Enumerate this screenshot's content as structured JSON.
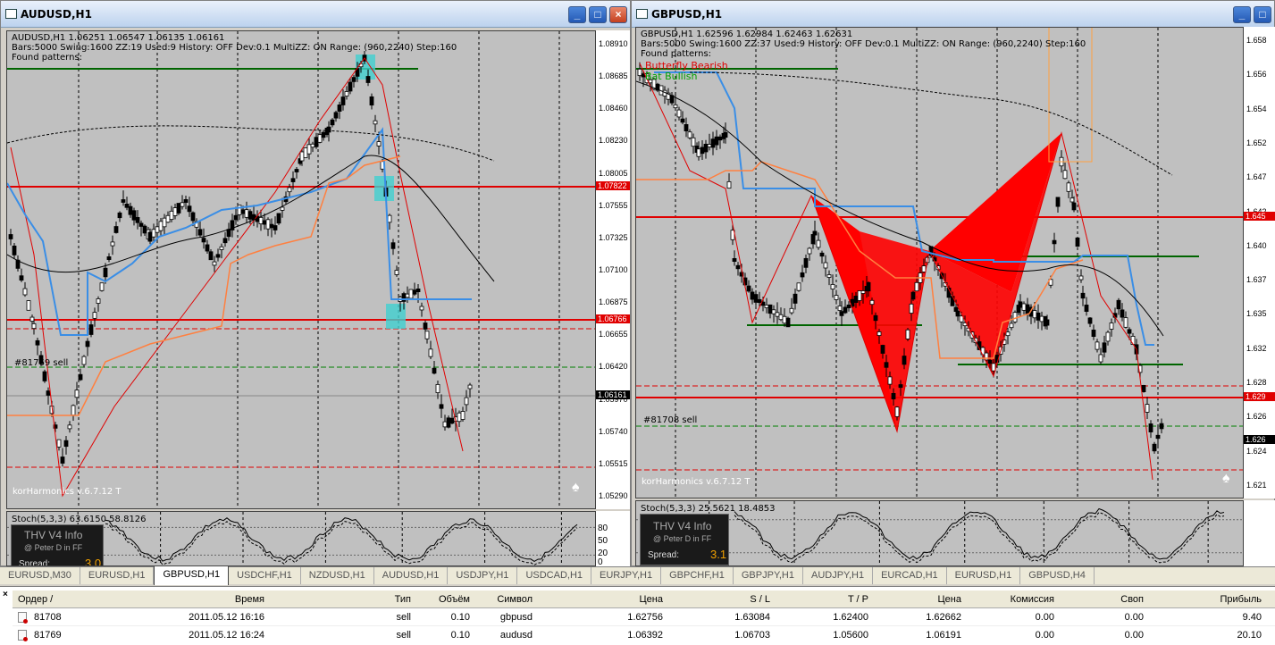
{
  "windows": [
    {
      "id": "audusd",
      "title": "AUDUSD,H1",
      "header_line1": "AUDUSD,H1  1.06251 1.06547 1.06135 1.06161",
      "header_line2": "Bars:5000  Swing:1600  ZZ:19  Used:9  History: OFF Dev:0.1  MultiZZ: ON  Range: (960,2240)  Step:160",
      "header_line3": "Found patterns:",
      "order_label": "#81769 sell",
      "brand": "korHarmonics v.6.7.12 T",
      "osc_label": "Stoch(5,3,3) 63.6150 58.8126",
      "price_labels": [
        "1.08910",
        "1.08685",
        "1.08460",
        "1.08230",
        "1.08005",
        "1.07555",
        "1.07325",
        "1.07100",
        "1.06875",
        "1.06655",
        "1.06420",
        "1.05970",
        "1.05740",
        "1.05515",
        "1.05290"
      ],
      "marker_red_1": "1.07822",
      "marker_red_2": "1.06766",
      "marker_black": "1.06161",
      "osc_ticks": [
        "80",
        "50",
        "20",
        "0"
      ],
      "thv": {
        "title": "THV  V4  Info",
        "sub": "@ Peter D in FF",
        "spread_label": "Spread:",
        "spread_value": "3.0"
      }
    },
    {
      "id": "gbpusd",
      "title": "GBPUSD,H1",
      "header_line1": "GBPUSD,H1  1.62596  1.62984  1.62463  1.62631",
      "header_line2": "Bars:5000  Swing:1600  ZZ:37  Used:9  History: OFF Dev:0.1  MultiZZ: ON  Range: (960,2240)  Step:160",
      "header_line3": "Found patterns:",
      "pattern1": "Butterfly Bearish",
      "pattern2": "Bat Bullish",
      "order_label": "#81708 sell",
      "brand": "korHarmonics v.6.7.12 T",
      "osc_label": "Stoch(5,3,3) 25.5621 18.4853",
      "price_labels": [
        "1.658",
        "1.656",
        "1.654",
        "1.652",
        "1.647",
        "1.642",
        "1.640",
        "1.637",
        "1.635",
        "1.632",
        "1.628",
        "1.626",
        "1.624",
        "1.621"
      ],
      "marker_red_1": "1.645",
      "marker_red_2": "1.629",
      "marker_black": "1.626",
      "thv": {
        "title": "THV  V4  Info",
        "sub": "@ Peter D in FF",
        "spread_label": "Spread:",
        "spread_value": "3.1"
      }
    }
  ],
  "tabs": [
    "EURUSD,M30",
    "EURUSD,H1",
    "GBPUSD,H1",
    "USDCHF,H1",
    "NZDUSD,H1",
    "AUDUSD,H1",
    "USDJPY,H1",
    "USDCAD,H1",
    "EURJPY,H1",
    "GBPCHF,H1",
    "GBPJPY,H1",
    "AUDJPY,H1",
    "EURCAD,H1",
    "EURUSD,H1",
    "GBPUSD,H4"
  ],
  "active_tab": 2,
  "terminal": {
    "close_glyph": "×",
    "columns": [
      "Ордер  /",
      "Время",
      "Тип",
      "Объём",
      "Символ",
      "Цена",
      "S / L",
      "T / P",
      "Цена",
      "Комиссия",
      "Своп",
      "Прибыль"
    ],
    "rows": [
      [
        "81708",
        "2011.05.12 16:16",
        "sell",
        "0.10",
        "gbpusd",
        "1.62756",
        "1.63084",
        "1.62400",
        "1.62662",
        "0.00",
        "0.00",
        "9.40"
      ],
      [
        "81769",
        "2011.05.12 16:24",
        "sell",
        "0.10",
        "audusd",
        "1.06392",
        "1.06703",
        "1.05600",
        "1.06191",
        "0.00",
        "0.00",
        "20.10"
      ]
    ]
  },
  "colors": {
    "red_line": "#e00000",
    "green_line": "#006400",
    "blue_line": "#3a8ee6",
    "orange_line": "#ff8040",
    "cyan": "#40d0d0"
  },
  "icons": [
    "window-icon",
    "minimize-icon",
    "maximize-icon",
    "close-icon",
    "order-icon",
    "logo-icon"
  ]
}
